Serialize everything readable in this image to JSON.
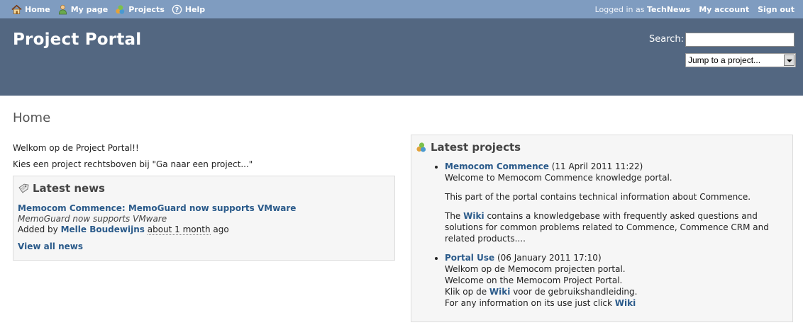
{
  "top_menu": {
    "items": [
      {
        "label": "Home",
        "icon": "home-icon"
      },
      {
        "label": "My page",
        "icon": "user-icon"
      },
      {
        "label": "Projects",
        "icon": "projects-icon"
      },
      {
        "label": "Help",
        "icon": "help-icon"
      }
    ],
    "logged_in_prefix": "Logged in as",
    "username": "TechNews",
    "my_account": "My account",
    "sign_out": "Sign out"
  },
  "header": {
    "title": "Project Portal",
    "search_label": "Search:",
    "search_value": "",
    "jump_select": "Jump to a project..."
  },
  "main": {
    "page_title": "Home",
    "welcome": "Welkom op de Project Portal!!",
    "instruction": "Kies een project rechtsboven bij \"Ga naar een project...\""
  },
  "news": {
    "heading": "Latest news",
    "item_title": "Memocom Commence: MemoGuard now supports VMware",
    "item_summary": "MemoGuard now supports VMware",
    "added_by": "Added by",
    "author": "Melle Boudewijns",
    "date": "about 1 month",
    "ago": "ago",
    "view_all": "View all news"
  },
  "projects": {
    "heading": "Latest projects",
    "items": [
      {
        "name": "Memocom Commence",
        "date": "(11 April 2011 11:22)",
        "line1": "Welcome to Memocom Commence knowledge portal.",
        "line2": "This part of the portal contains technical information about Commence.",
        "line3_pre": "The",
        "line3_link": "Wiki",
        "line3_post": "contains a knowledgebase with frequently asked questions and solutions for common problems related to Commence, Commence CRM and related products...."
      },
      {
        "name": "Portal Use",
        "date": "(06 January 2011 17:10)",
        "line1": "Welkom op de Memocom projecten portal.",
        "line2": "Welcome on the Memocom Project Portal.",
        "line3_pre": "Klik op de",
        "line3_link": "Wiki",
        "line3_post": "voor de gebruikshandleiding.",
        "line4_pre": "For any information on its use just click",
        "line4_link": "Wiki"
      }
    ]
  },
  "colors": {
    "top_menu_bg": "#7f9cc0",
    "header_bg": "#536781",
    "link": "#2a5a8a",
    "box_bg": "#f6f6f6"
  }
}
